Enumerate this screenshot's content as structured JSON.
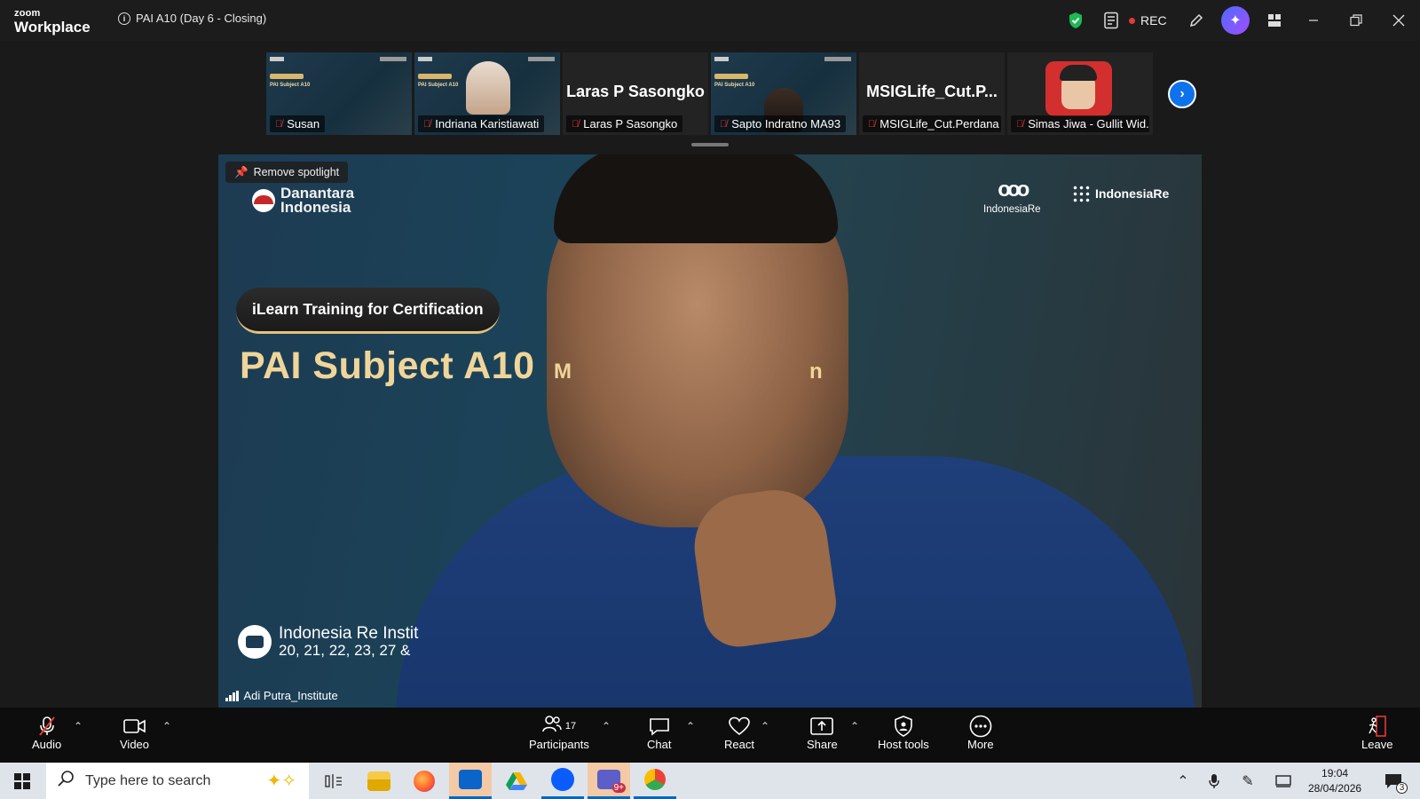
{
  "window": {
    "brand_top": "zoom",
    "brand_bottom": "Workplace",
    "meeting_title": "PAI A10 (Day 6 - Closing)",
    "rec_label": "REC",
    "icons": [
      "shield-check-icon",
      "notes-icon",
      "record-icon",
      "pencil-icon",
      "ai-companion-icon",
      "apps-icon",
      "minimize-icon",
      "restore-icon",
      "close-icon"
    ]
  },
  "gallery": {
    "tiles": [
      {
        "name": "Susan",
        "type": "slide"
      },
      {
        "name": "Indriana Karistiawati",
        "type": "slide-person"
      },
      {
        "name": "Laras P Sasongko",
        "type": "name-only",
        "big_name": "Laras P Sasongko"
      },
      {
        "name": "Sapto Indratno MA93",
        "type": "slide-person"
      },
      {
        "name": "MSIGLife_Cut.Perdana",
        "type": "name-only",
        "big_name": "MSIGLife_Cut.P..."
      },
      {
        "name": "Simas Jiwa - Gullit Wid...",
        "type": "avatar"
      }
    ],
    "mini_slide_title": "PAI Subject A10"
  },
  "stage": {
    "spotlight_button": "Remove spotlight",
    "logo_left_line1": "Danantara",
    "logo_left_line2": "Indonesia",
    "logo_ire_name": "IndonesiaRe",
    "logo_iri_name": "IndonesiaRe",
    "pill_text": "iLearn Training for Certification",
    "subject_text": "PAI Subject A10",
    "subject_tail_left": "M",
    "subject_tail_right": "n",
    "footer_line1": "Indonesia Re Instit",
    "footer_line2": "20, 21, 22, 23, 27 &",
    "speaker_name": "Adi Putra_Institute"
  },
  "toolbar": {
    "audio": "Audio",
    "video": "Video",
    "participants": "Participants",
    "participants_count": "17",
    "chat": "Chat",
    "react": "React",
    "share": "Share",
    "host_tools": "Host tools",
    "more": "More",
    "leave": "Leave"
  },
  "taskbar": {
    "search_placeholder": "Type here to search",
    "time": "19:04",
    "date": "28/04/2026",
    "notification_count": "3",
    "teams_badge": "9+"
  },
  "colors": {
    "accent_blue": "#0e72ed",
    "mic_off_red": "#e53935",
    "slide_gold": "#f0d59a",
    "shield_green": "#1db954"
  }
}
